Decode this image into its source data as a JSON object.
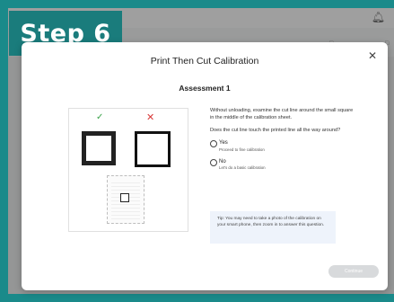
{
  "step_badge": "Step 6",
  "dialog": {
    "title": "Print Then Cut Calibration",
    "close_icon": "close-icon",
    "subtitle": "Assessment 1",
    "instruction": "Without unloading, examine the cut line around the small square in the middle of the calibration sheet.",
    "question": "Does the cut line touch the printed line all the way around?",
    "options": [
      {
        "label": "Yes",
        "sub": "Proceed to fine calibration"
      },
      {
        "label": "No",
        "sub": "Let's do a basic calibration"
      }
    ],
    "tip": "Tip: You may need to take a photo of the calibration on your smart phone, then zoom in to answer this question.",
    "continue_label": "Continue"
  },
  "colors": {
    "brand_teal": "#1a7c7c",
    "good_check": "#3aa34a",
    "bad_cross": "#d83a3a"
  }
}
